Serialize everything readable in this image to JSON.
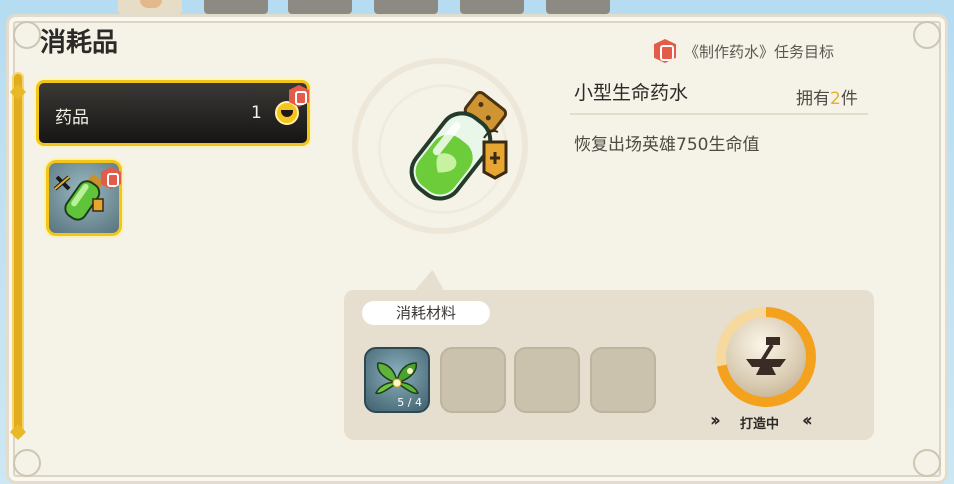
{
  "title": "消耗品",
  "quest": {
    "text": "《制作药水》任务目标",
    "icon": "quest-badge-icon"
  },
  "category": {
    "label": "药品",
    "count": "1",
    "icon": "collapse-toggle-icon"
  },
  "item": {
    "name": "小型生命药水",
    "own_prefix": "拥有",
    "own_count": "2",
    "own_suffix": "件",
    "description": "恢复出场英雄750生命值",
    "icon": "green-potion-icon"
  },
  "materials": {
    "label": "消耗材料",
    "slots": [
      {
        "icon": "herb-leaf-icon",
        "count": "5 / 4"
      },
      {
        "icon": ""
      },
      {
        "icon": ""
      },
      {
        "icon": ""
      }
    ]
  },
  "craft": {
    "status": "打造中",
    "icon": "anvil-hammer-icon",
    "progress": 0.72
  },
  "colors": {
    "accent": "#f1c51a",
    "quest": "#e45b4a",
    "progress": "#f4a21e",
    "panel": "#f5f2e8"
  }
}
